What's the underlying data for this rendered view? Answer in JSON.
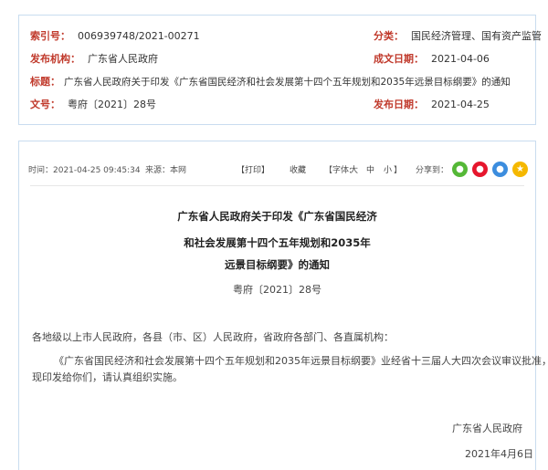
{
  "meta": {
    "index_label": "索引号：",
    "index_value": "006939748/2021-00271",
    "category_label": "分类：",
    "category_value": "国民经济管理、国有资产监管",
    "issuer_label": "发布机构：",
    "issuer_value": "广东省人民政府",
    "created_label": "成文日期：",
    "created_value": "2021-04-06",
    "title_label": "标题：",
    "title_value": "广东省人民政府关于印发《广东省国民经济和社会发展第十四个五年规划和2035年远景目标纲要》的通知",
    "docno_label": "文号：",
    "docno_value": "粤府〔2021〕28号",
    "published_label": "发布日期：",
    "published_value": "2021-04-25"
  },
  "toolbar": {
    "time": "时间：2021-04-25 09:45:34",
    "source": "来源：本网",
    "print": "【打印】",
    "favorite": "收藏",
    "font_label": "【字体:",
    "font_large": "大",
    "font_medium": "中",
    "font_small": "小",
    "font_close": "】",
    "share_label": "分享到："
  },
  "share_icons": [
    {
      "name": "wechat-icon",
      "glyph": "●",
      "color": "#55b837"
    },
    {
      "name": "weibo-icon",
      "glyph": "●",
      "color": "#e6162d"
    },
    {
      "name": "qq-icon",
      "glyph": "●",
      "color": "#3c8dde"
    },
    {
      "name": "qzone-icon",
      "glyph": "★",
      "color": "#f5b800"
    }
  ],
  "article": {
    "title_line1": "广东省人民政府关于印发《广东省国民经济",
    "title_line2": "和社会发展第十四个五年规划和2035年",
    "title_line3": "远景目标纲要》的通知",
    "doc_number": "粤府〔2021〕28号",
    "addressee": "各地级以上市人民政府，各县（市、区）人民政府，省政府各部门、各直属机构：",
    "para1_line1": "《广东省国民经济和社会发展第十四个五年规划和2035年远景目标纲要》业经省十三届人大四次会议审议批准，",
    "para1_line2": "现印发给你们，请认真组织实施。",
    "signature": "广东省人民政府",
    "date": "2021年4月6日"
  }
}
